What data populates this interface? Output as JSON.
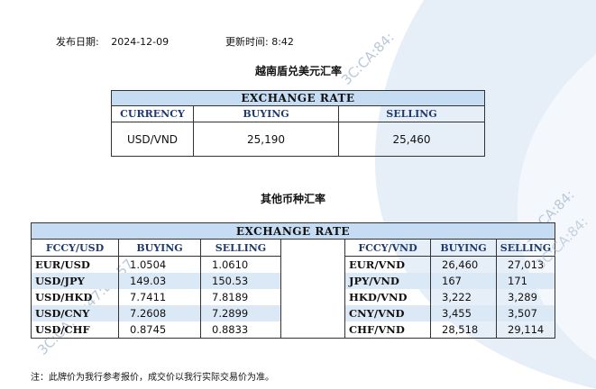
{
  "header": {
    "date_label": "发布日期:",
    "date_value": "2024-12-09",
    "time_label": "更新时间:",
    "time_value": "8:42"
  },
  "usd_vnd": {
    "section_title": "越南盾兑美元汇率",
    "table_title": "EXCHANGE RATE",
    "columns": [
      "CURRENCY",
      "BUYING",
      "SELLING"
    ],
    "row": {
      "pair": "USD/VND",
      "buying": "25,190",
      "selling": "25,460"
    }
  },
  "other": {
    "section_title": "其他币种汇率",
    "table_title": "EXCHANGE  RATE",
    "left_columns": [
      "FCCY/USD",
      "BUYING",
      "SELLING"
    ],
    "right_columns": [
      "FCCY/VND",
      "BUYING",
      "SELLING"
    ],
    "rows": [
      {
        "l_pair": "EUR/USD",
        "l_buy": "1.0504",
        "l_sell": "1.0610",
        "r_pair": "EUR/VND",
        "r_buy": "26,460",
        "r_sell": "27,013"
      },
      {
        "l_pair": "USD/JPY",
        "l_buy": "149.03",
        "l_sell": "150.53",
        "r_pair": "JPY/VND",
        "r_buy": "167",
        "r_sell": "171"
      },
      {
        "l_pair": "USD/HKD",
        "l_buy": "7.7411",
        "l_sell": "7.8189",
        "r_pair": "HKD/VND",
        "r_buy": "3,222",
        "r_sell": "3,289"
      },
      {
        "l_pair": "USD/CNY",
        "l_buy": "7.2608",
        "l_sell": "7.2899",
        "r_pair": "CNY/VND",
        "r_buy": "3,455",
        "r_sell": "3,507"
      },
      {
        "l_pair": "USD/CHF",
        "l_buy": "0.8745",
        "l_sell": "0.8833",
        "r_pair": "CHF/VND",
        "r_buy": "28,518",
        "r_sell": "29,114"
      }
    ]
  },
  "note": "注：此牌价为我行参考报价，成交价以我行实际交易价为准。",
  "watermarks": [
    "3C:CA:84:",
    "3C:CA:84:",
    "3C:CA:84:47:B7:57",
    "3C:CA:84:"
  ],
  "colors": {
    "header_fill": "#c5dcf2",
    "row_alt": "#dbe8f6",
    "header_text": "#1f3a6e",
    "decor": "#dde9f5"
  }
}
